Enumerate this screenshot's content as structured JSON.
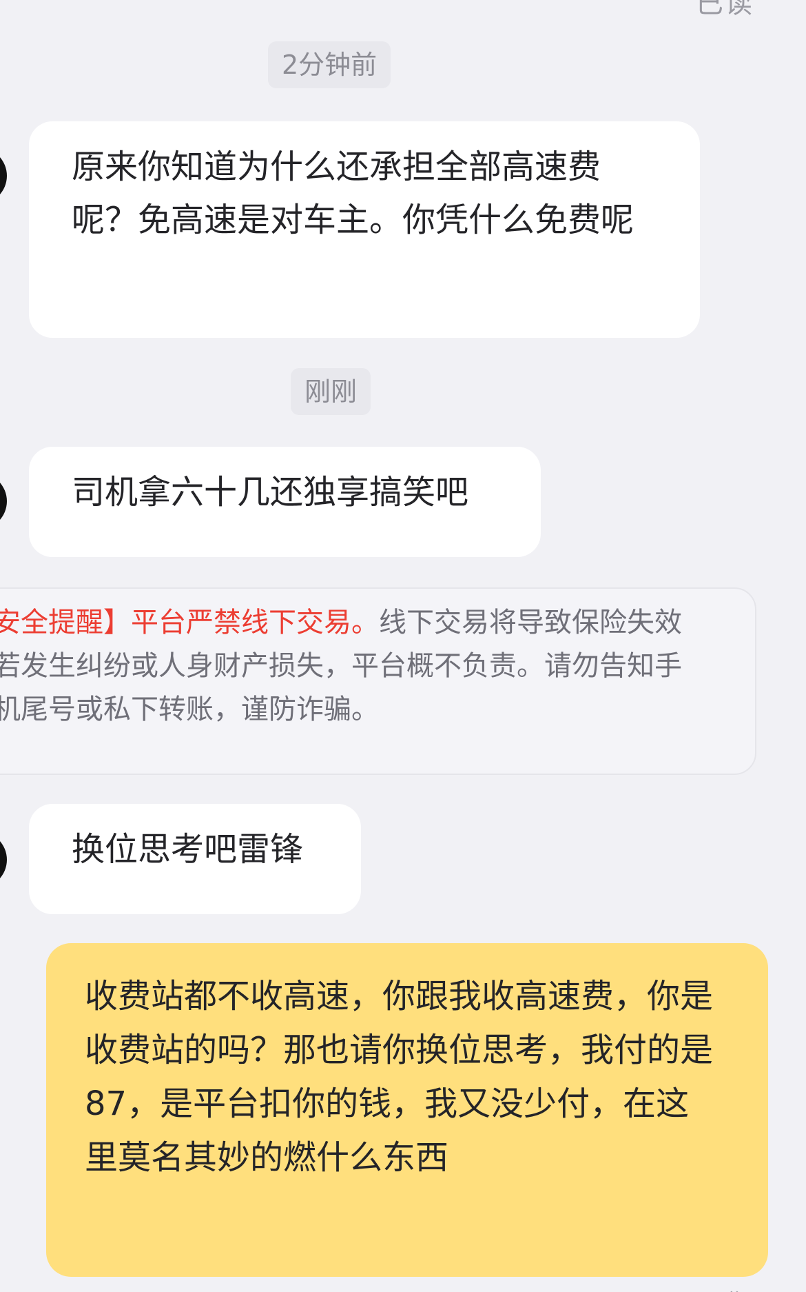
{
  "chat": {
    "top_status_partial": "已读",
    "timestamps": {
      "first": "2分钟前",
      "second": "刚刚"
    },
    "messages": {
      "incoming_1": "原来你知道为什么还承担全部高速费呢？免高速是对车主。你凭什么免费呢",
      "incoming_2": "司机拿六十几还独享搞笑吧",
      "incoming_3": "换位思考吧雷锋",
      "outgoing_1": "收费站都不收高速，你跟我收高速费，你是收费站的吗？那也请你换位思考，我付的是87，是平台扣你的钱，我又没少付，在这里莫名其妙的燃什么东西"
    },
    "safety_notice": {
      "red_text": "安全提醒】平台严禁线下交易。",
      "gray_text": "线下交易将导致保险失效若发生纠纷或人身财产损失，平台概不负责。请勿告知手机尾号或私下转账，谨防诈骗。"
    },
    "colors": {
      "page_background": "#f1f1f5",
      "incoming_bubble": "#ffffff",
      "outgoing_bubble": "#ffdf7d",
      "notice_red": "#ec3d32",
      "text_primary": "#242428",
      "text_secondary": "#8c8c94"
    },
    "icons": {
      "avatar": "contact-avatar-icon"
    }
  }
}
